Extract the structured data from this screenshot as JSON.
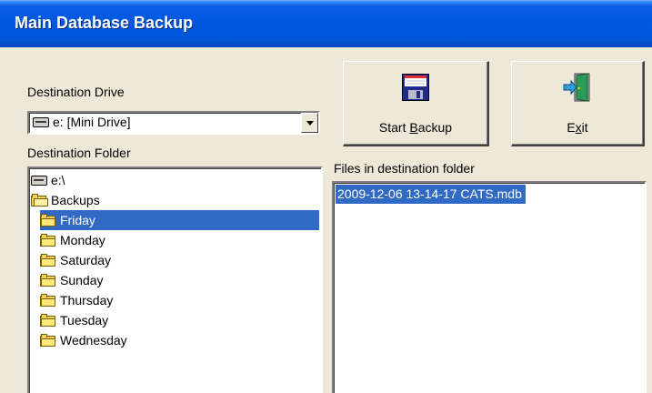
{
  "window": {
    "title": "Main Database Backup"
  },
  "destination_drive": {
    "label": "Destination Drive",
    "selected": "e: [Mini Drive]",
    "icon": "drive-icon"
  },
  "destination_folder": {
    "label": "Destination Folder",
    "items": [
      {
        "label": "e:\\",
        "icon": "drive-icon",
        "selected": false
      },
      {
        "label": "Backups",
        "icon": "open-folder-icon",
        "selected": false
      },
      {
        "label": "Friday",
        "icon": "folder-icon",
        "selected": true
      },
      {
        "label": "Monday",
        "icon": "folder-icon",
        "selected": false
      },
      {
        "label": "Saturday",
        "icon": "folder-icon",
        "selected": false
      },
      {
        "label": "Sunday",
        "icon": "folder-icon",
        "selected": false
      },
      {
        "label": "Thursday",
        "icon": "folder-icon",
        "selected": false
      },
      {
        "label": "Tuesday",
        "icon": "folder-icon",
        "selected": false
      },
      {
        "label": "Wednesday",
        "icon": "folder-icon",
        "selected": false
      }
    ]
  },
  "files_panel": {
    "label": "Files in destination folder",
    "files": [
      "2009-12-06 13-14-17 CATS.mdb"
    ]
  },
  "buttons": {
    "start_backup": {
      "label_pre": "Start ",
      "label_accel": "B",
      "label_post": "ackup",
      "icon": "floppy-disk-icon"
    },
    "exit": {
      "label_pre": "E",
      "label_accel": "x",
      "label_post": "it",
      "icon": "exit-door-icon"
    }
  },
  "colors": {
    "selection": "#316ac5",
    "face": "#ece9d8",
    "titlebar": "#0058e0"
  }
}
